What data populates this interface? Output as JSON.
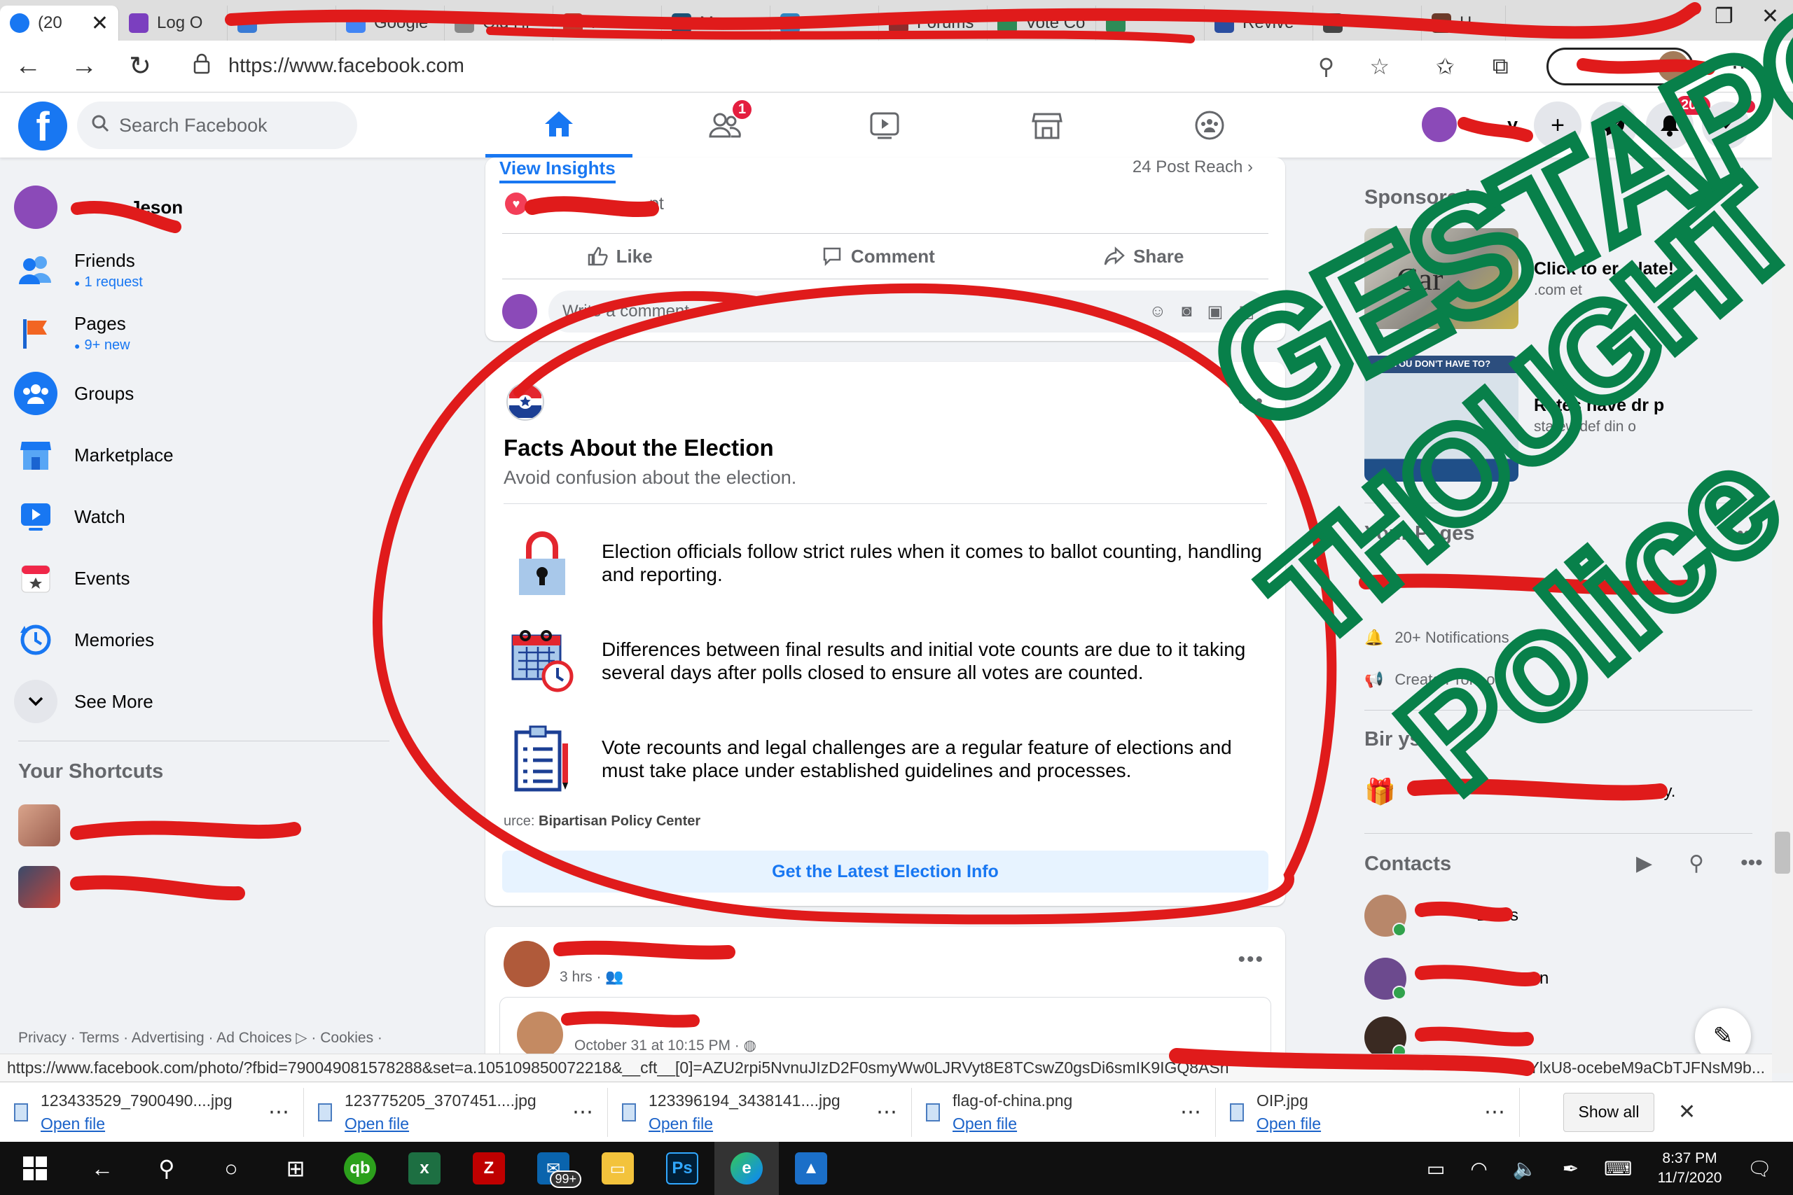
{
  "browser": {
    "tabs": [
      {
        "label": "(20",
        "color": "#1877f2"
      },
      {
        "label": "Log O",
        "color": "#7b3fbf"
      },
      {
        "label": "",
        "color": "#3a7bd5"
      },
      {
        "label": "Google",
        "color": "#4285f4"
      },
      {
        "label": "Old Hi",
        "color": "#888888"
      },
      {
        "label": "Fa",
        "color": "#c0392b"
      },
      {
        "label": "M",
        "color": "#1a5276"
      },
      {
        "label": "",
        "color": "#2e86c1"
      },
      {
        "label": "Forums",
        "color": "#8e2c2c"
      },
      {
        "label": "Vote Co",
        "color": "#2e8b57"
      },
      {
        "label": "",
        "color": "#2e8b57"
      },
      {
        "label": "Revive",
        "color": "#2b4ea0"
      },
      {
        "label": "",
        "color": "#444444"
      },
      {
        "label": "H",
        "color": "#6b3a2a"
      }
    ],
    "url": "https://www.facebook.com",
    "status_url": "https://www.facebook.com/photo/?fbid=790049081578288&set=a.105109850072218&__cft__[0]=AZU2rpi5NvnuJIzD2F0smyWw0LJRVyt8E8TCswZ0gsDi6smIK9IGQ8ASh",
    "status_url_end": "mYlxU8-ocebeM9aCbTJFNsM9b..."
  },
  "header": {
    "search_placeholder": "Search Facebook",
    "friends_badge": "1",
    "notif_badge": "20+",
    "user_name_tail": "y"
  },
  "sidebar": {
    "user_name_tail": "son",
    "user_name_mid": "Je",
    "items": [
      {
        "label": "Friends",
        "sub": "1 request"
      },
      {
        "label": "Pages",
        "sub": "9+ new"
      },
      {
        "label": "Groups"
      },
      {
        "label": "Marketplace"
      },
      {
        "label": "Watch"
      },
      {
        "label": "Events"
      },
      {
        "label": "Memories"
      },
      {
        "label": "See More"
      }
    ],
    "shortcuts_title": "Your Shortcuts",
    "footer": "Privacy · Terms · Advertising · Ad Choices ▷ · Cookies ·"
  },
  "post1": {
    "view_insights": "View Insights",
    "post_reach": "24 Post Reach",
    "reaction_tail": "pt",
    "like": "Like",
    "comment": "Comment",
    "share": "Share",
    "comment_placeholder": "Write a comment..."
  },
  "election": {
    "title": "Facts About the Election",
    "subtitle": "Avoid confusion about the election.",
    "facts": [
      "Election officials follow strict rules when it comes to ballot counting, handling and reporting.",
      "Differences between final results and initial vote counts are due to it taking several days after polls closed to ensure all votes are counted.",
      "Vote recounts and legal challenges are a regular feature of elections and must take place under established guidelines and processes."
    ],
    "source_prefix": "urce:",
    "source_name": "Bipartisan Policy Center",
    "button": "Get the Latest Election Info"
  },
  "post2": {
    "time": "3 hrs ·",
    "shared_time": "October 31 at 10:15 PM ·"
  },
  "right": {
    "sponsored": "Sponsored",
    "ad1_title": "Click to        er c    late!",
    "ad1_domain": "     .com      et",
    "ad1_img_text": "Car",
    "ad2_banner": "...EN YOU DON'T HAVE TO?",
    "ad2_title": "Rates have dr   p",
    "ad2_domain": "statewidef   din      o",
    "your_pages": "Your Pages",
    "pages_suffix": "nds",
    "notifications": "20+ Notifications",
    "create_promo": "Create Prom      on",
    "birthdays": "Bir      ys",
    "birthday_tail": "today.",
    "contacts": "Contacts",
    "contact_tails": [
      "Davis",
      "n",
      "..."
    ]
  },
  "downloads": {
    "files": [
      "123433529_7900490....jpg",
      "123775205_3707451....jpg",
      "123396194_3438141....jpg",
      "flag-of-china.png",
      "OIP.jpg"
    ],
    "open_label": "Open file",
    "show_all": "Show all"
  },
  "taskbar": {
    "time": "8:37 PM",
    "date": "11/7/2020",
    "badge": "99+"
  },
  "annotation": {
    "text_line1": "GESTAPO",
    "text_line2": "THOUGHT",
    "text_line3": "Police",
    "red": "#e01b1b",
    "green": "#08804a"
  }
}
